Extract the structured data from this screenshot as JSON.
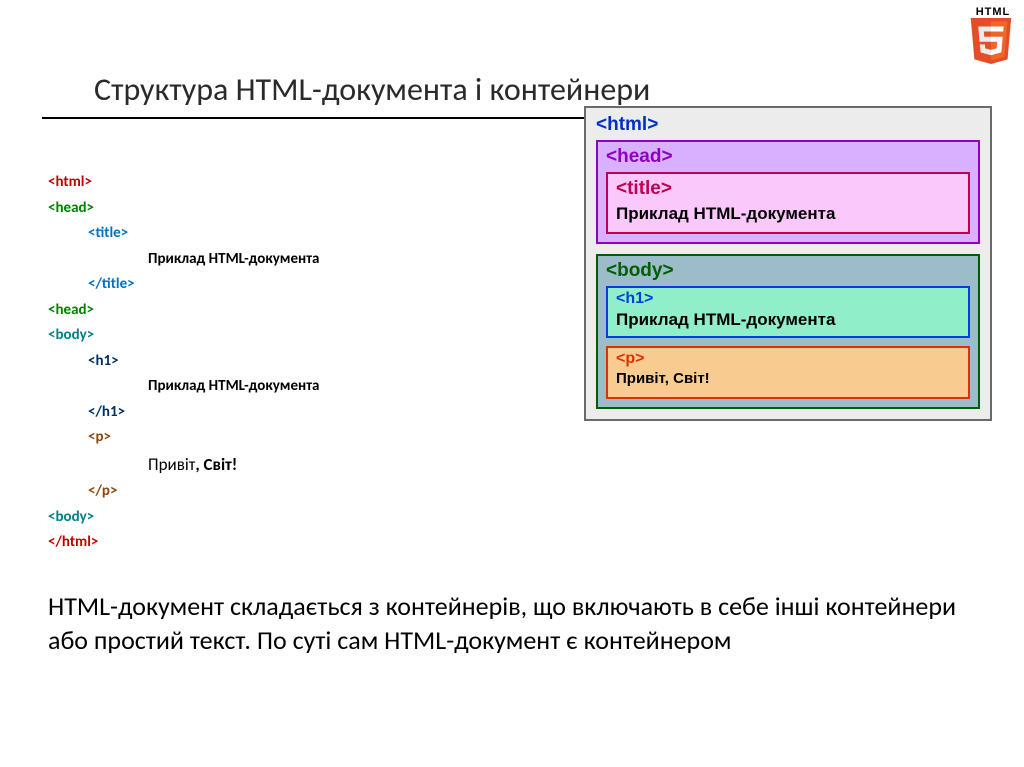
{
  "logo": {
    "label": "HTML",
    "five": "5"
  },
  "title": "Структура HTML-документа і контейнери",
  "code": {
    "html_open": "<html>",
    "head_open": "<head>",
    "title_open": "<title>",
    "title_text": "Приклад HTML-документа",
    "title_close": "</title>",
    "head_close": "<head>",
    "body_open": "<body>",
    "h1_open": "<h1>",
    "h1_text": "Приклад HTML-документа",
    "h1_close": "</h1>",
    "p_open": "<p>",
    "p_text_a": "Привіт",
    "p_text_b": ", Світ!",
    "p_close": "</p>",
    "body_close": "<body>",
    "html_close": "</html>"
  },
  "diagram": {
    "html": "<html>",
    "head": "<head>",
    "title": "<title>",
    "title_content": "Приклад HTML-документа",
    "body": "<body>",
    "h1": "<h1>",
    "h1_content": "Приклад HTML-документа",
    "p": "<p>",
    "p_content": "Привіт, Світ!"
  },
  "description": "HTML-документ складається з контейнерів, що включають в себе інші контейнери або простий текст. По суті сам HTML-документ є контейнером"
}
